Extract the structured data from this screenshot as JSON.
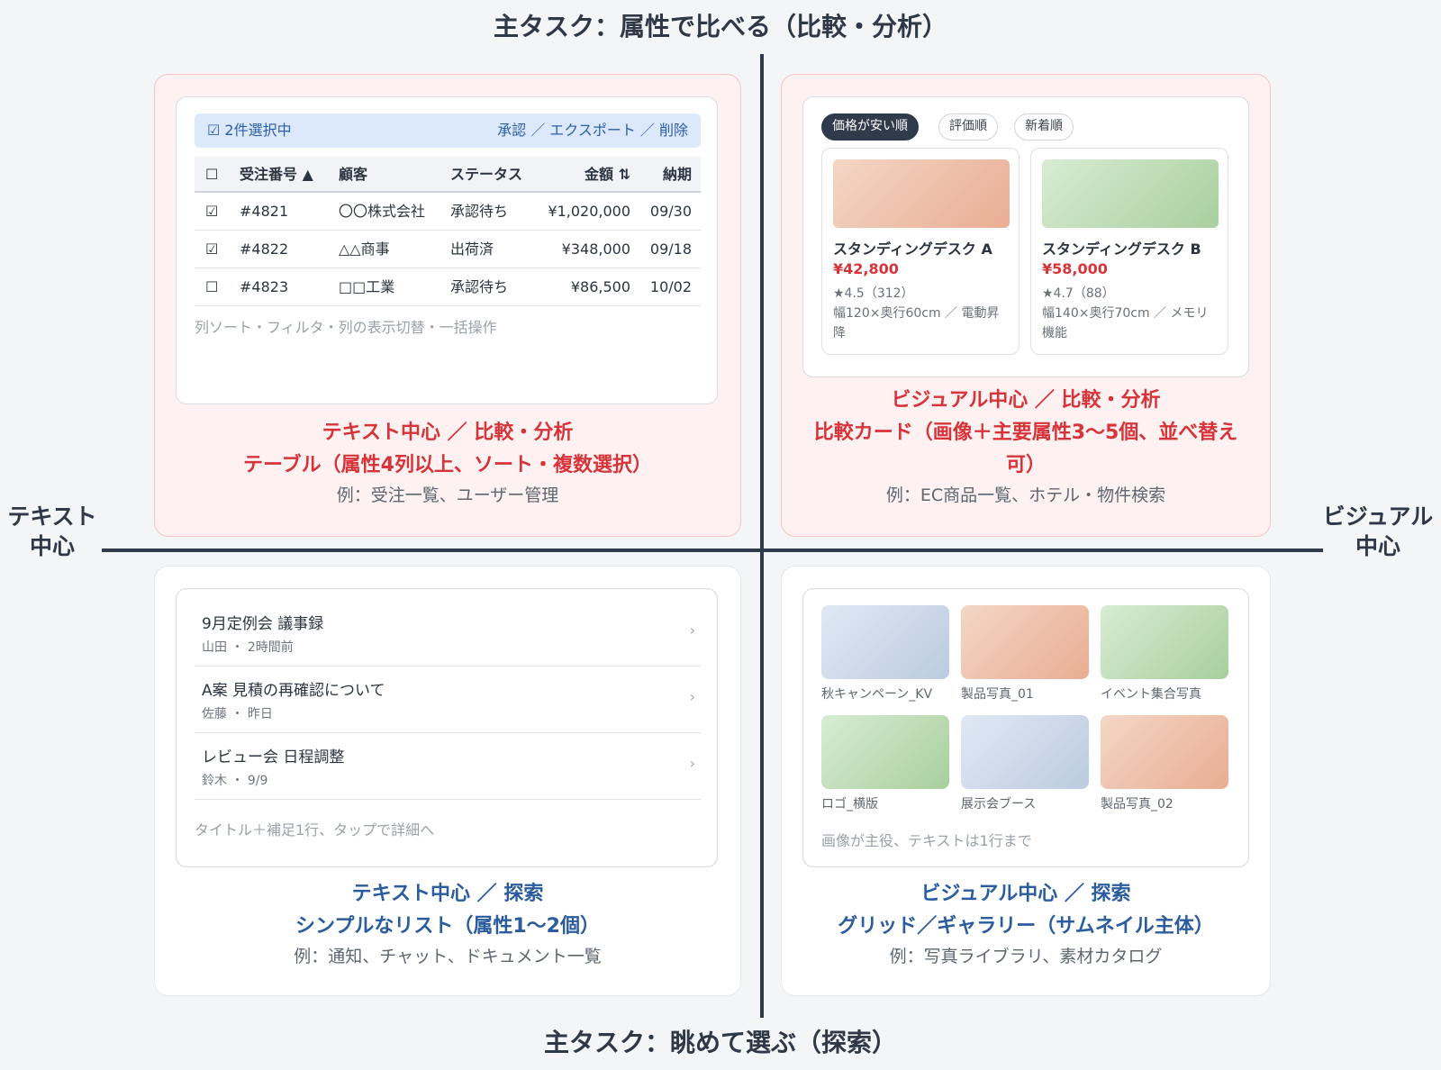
{
  "axes": {
    "top": "主タスク：属性で比べる（比較・分析）",
    "bottom": "主タスク：眺めて選ぶ（探索）",
    "left_line1": "テキスト",
    "left_line2": "中心",
    "right_line1": "ビジュアル",
    "right_line2": "中心"
  },
  "q_text_compare": {
    "selection_bar": {
      "selected": "☑ 2件選択中",
      "actions": "承認 ／ エクスポート ／ 削除"
    },
    "table": {
      "headers": {
        "check": "☐",
        "order_no": "受注番号 ▲",
        "customer": "顧客",
        "status": "ステータス",
        "amount": "金額 ⇅",
        "due": "納期"
      },
      "rows": [
        {
          "check": "☑",
          "order_no": "#4821",
          "customer": "〇〇株式会社",
          "status": "承認待ち",
          "amount": "¥1,020,000",
          "due": "09/30"
        },
        {
          "check": "☑",
          "order_no": "#4822",
          "customer": "△△商事",
          "status": "出荷済",
          "amount": "¥348,000",
          "due": "09/18"
        },
        {
          "check": "☐",
          "order_no": "#4823",
          "customer": "□□工業",
          "status": "承認待ち",
          "amount": "¥86,500",
          "due": "10/02"
        }
      ]
    },
    "hint": "列ソート・フィルタ・列の表示切替・一括操作",
    "caption": {
      "line1": "テキスト中心 ／ 比較・分析",
      "line2": "テーブル（属性4列以上、ソート・複数選択）",
      "line3": "例：受注一覧、ユーザー管理"
    }
  },
  "q_visual_compare": {
    "sort_chips": [
      "価格が安い順",
      "評価順",
      "新着順"
    ],
    "products": [
      {
        "name": "スタンディングデスク A",
        "price": "¥42,800",
        "rating": "★4.5（312）",
        "spec": "幅120×奥行60cm ／ 電動昇降"
      },
      {
        "name": "スタンディングデスク B",
        "price": "¥58,000",
        "rating": "★4.7（88）",
        "spec": "幅140×奥行70cm ／ メモリ機能"
      }
    ],
    "caption": {
      "line1": "ビジュアル中心 ／ 比較・分析",
      "line2": "比較カード（画像＋主要属性3〜5個、並べ替え可）",
      "line3": "例：EC商品一覧、ホテル・物件検索"
    }
  },
  "q_text_explore": {
    "items": [
      {
        "title": "9月定例会 議事録",
        "sub": "山田 ・ 2時間前"
      },
      {
        "title": "A案 見積の再確認について",
        "sub": "佐藤 ・ 昨日"
      },
      {
        "title": "レビュー会 日程調整",
        "sub": "鈴木 ・ 9/9"
      }
    ],
    "chevron": "›",
    "hint": "タイトル＋補足1行、タップで詳細へ",
    "caption": {
      "line1": "テキスト中心 ／ 探索",
      "line2": "シンプルなリスト（属性1〜2個）",
      "line3": "例：通知、チャット、ドキュメント一覧"
    }
  },
  "q_visual_explore": {
    "tiles": [
      {
        "label": "秋キャンペーン_KV",
        "tone": "blue"
      },
      {
        "label": "製品写真_01",
        "tone": "peach"
      },
      {
        "label": "イベント集合写真",
        "tone": "green"
      },
      {
        "label": "ロゴ_横版",
        "tone": "green"
      },
      {
        "label": "展示会ブース",
        "tone": "blue"
      },
      {
        "label": "製品写真_02",
        "tone": "peach"
      }
    ],
    "hint": "画像が主役、テキストは1行まで",
    "caption": {
      "line1": "ビジュアル中心 ／ 探索",
      "line2": "グリッド／ギャラリー（サムネイル主体）",
      "line3": "例：写真ライブラリ、素材カタログ"
    }
  },
  "colors": {
    "accent_red": "#d7343a",
    "accent_blue": "#2a5c9e",
    "axis": "#2f3b4a",
    "quadrant_red_bg": "#fdf1f1"
  }
}
